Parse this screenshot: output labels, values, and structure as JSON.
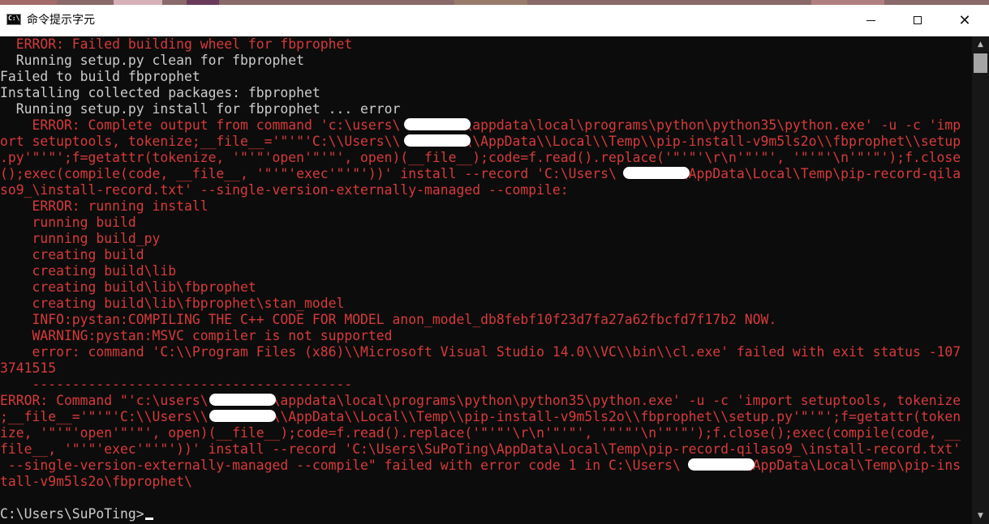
{
  "window": {
    "title": "命令提示字元",
    "icon": "cmd-icon",
    "icon_text": "C:\\",
    "controls": [
      "minimize-icon",
      "maximize-icon",
      "close-icon"
    ]
  },
  "colors": {
    "background": "#0c0c0c",
    "text": "#cccccc",
    "error": "#d63a3a"
  },
  "console": {
    "lines": [
      {
        "text": "  ERROR: Failed building wheel for fbprophet",
        "color": "red"
      },
      {
        "text": "  Running setup.py clean for fbprophet",
        "color": "white"
      },
      {
        "text": "Failed to build fbprophet",
        "color": "white"
      },
      {
        "text": "Installing collected packages: fbprophet",
        "color": "white"
      },
      {
        "text": "  Running setup.py install for fbprophet ... error",
        "color": "white"
      },
      {
        "text": "    ERROR: Complete output from command 'c:\\users\\        \\appdata\\local\\programs\\python\\python35\\python.exe' -u -c 'imp",
        "color": "red"
      },
      {
        "text": "ort setuptools, tokenize;__file__='\"'\"'C:\\\\Users\\\\        \\\\AppData\\\\Local\\\\Temp\\\\pip-install-v9m5ls2o\\\\fbprophet\\\\setup",
        "color": "red"
      },
      {
        "text": ".py'\"'\"';f=getattr(tokenize, '\"'\"'open'\"'\"', open)(__file__);code=f.read().replace('\"'\"'\\r\\n'\"'\"', '\"'\"'\\n'\"'\"');f.close",
        "color": "red"
      },
      {
        "text": "();exec(compile(code, __file__, '\"'\"'exec'\"'\"'))' install --record 'C:\\Users\\        \\AppData\\Local\\Temp\\pip-record-qila",
        "color": "red"
      },
      {
        "text": "so9_\\install-record.txt' --single-version-externally-managed --compile:",
        "color": "red"
      },
      {
        "text": "    ERROR: running install",
        "color": "red"
      },
      {
        "text": "    running build",
        "color": "red"
      },
      {
        "text": "    running build_py",
        "color": "red"
      },
      {
        "text": "    creating build",
        "color": "red"
      },
      {
        "text": "    creating build\\lib",
        "color": "red"
      },
      {
        "text": "    creating build\\lib\\fbprophet",
        "color": "red"
      },
      {
        "text": "    creating build\\lib\\fbprophet\\stan_model",
        "color": "red"
      },
      {
        "text": "    INFO:pystan:COMPILING THE C++ CODE FOR MODEL anon_model_db8febf10f23d7fa27a62fbcfd7f17b2 NOW.",
        "color": "red"
      },
      {
        "text": "    WARNING:pystan:MSVC compiler is not supported",
        "color": "red"
      },
      {
        "text": "    error: command 'C:\\\\Program Files (x86)\\\\Microsoft Visual Studio 14.0\\\\VC\\\\bin\\\\cl.exe' failed with exit status -107",
        "color": "red"
      },
      {
        "text": "3741515",
        "color": "red"
      },
      {
        "text": "    ----------------------------------------",
        "color": "red"
      },
      {
        "text": "ERROR: Command \"'c:\\users\\        \\appdata\\local\\programs\\python\\python35\\python.exe' -u -c 'import setuptools, tokenize",
        "color": "red"
      },
      {
        "text": ";__file__='\"'\"'C:\\\\Users\\\\        \\\\AppData\\\\Local\\\\Temp\\\\pip-install-v9m5ls2o\\\\fbprophet\\\\setup.py'\"'\"';f=getattr(token",
        "color": "red"
      },
      {
        "text": "ize, '\"'\"'open'\"'\"', open)(__file__);code=f.read().replace('\"'\"'\\r\\n'\"'\"', '\"'\"'\\n'\"'\"');f.close();exec(compile(code, __",
        "color": "red"
      },
      {
        "text": "file__, '\"'\"'exec'\"'\"'))' install --record 'C:\\Users\\SuPoTing\\AppData\\Local\\Temp\\pip-record-qilaso9_\\install-record.txt'",
        "color": "red"
      },
      {
        "text": " --single-version-externally-managed --compile\" failed with error code 1 in C:\\Users\\        \\AppData\\Local\\Temp\\pip-ins",
        "color": "red"
      },
      {
        "text": "tall-v9m5ls2o\\fbprophet\\",
        "color": "red"
      },
      {
        "text": "",
        "color": "white"
      },
      {
        "text": "C:\\Users\\SuPoTing>",
        "color": "white",
        "cursor": true
      }
    ]
  }
}
